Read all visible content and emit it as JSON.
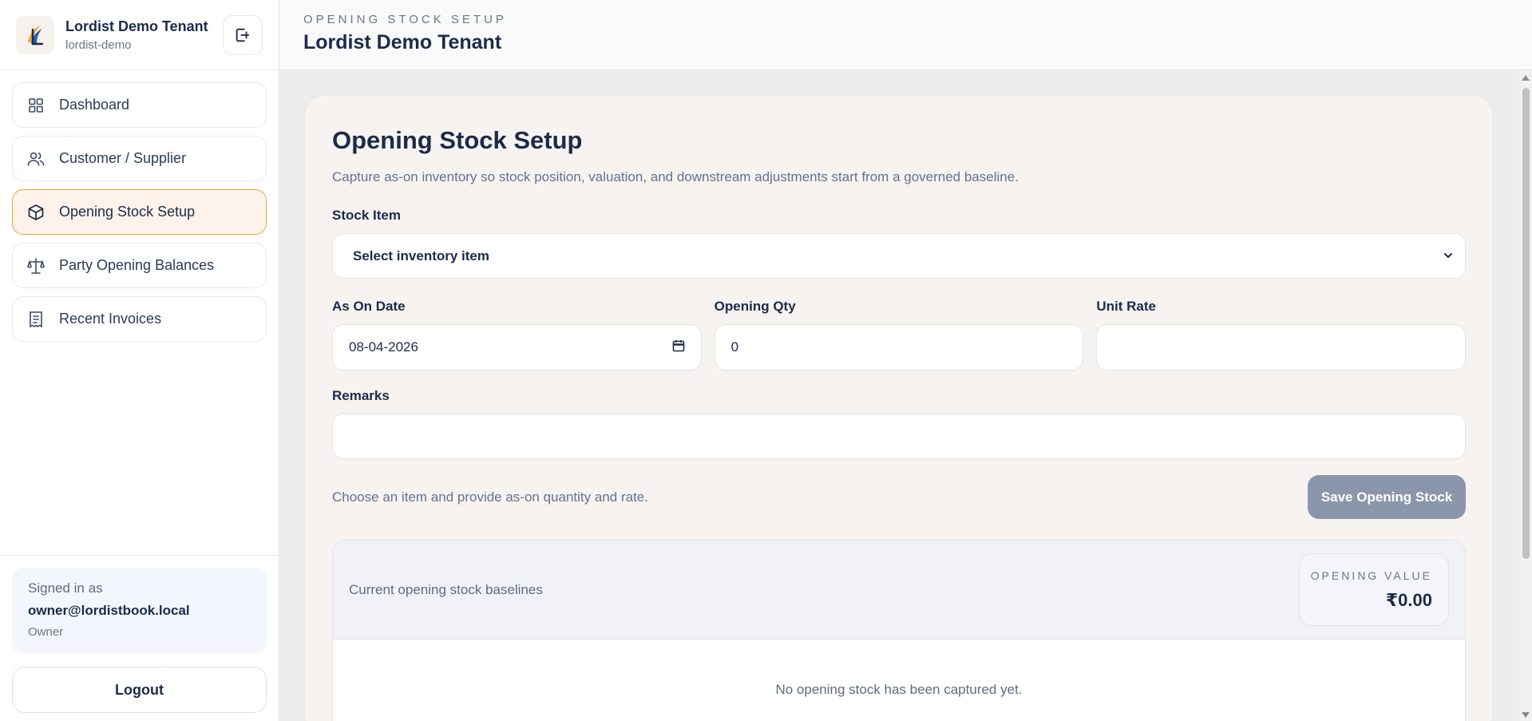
{
  "brand": {
    "title": "Lordist Demo Tenant",
    "subtitle": "lordist-demo",
    "logo_icon": "lordist-logo-icon",
    "collapse_icon": "sign-out-square-icon"
  },
  "sidebar": {
    "items": [
      {
        "label": "Dashboard",
        "icon": "grid-icon",
        "active": false
      },
      {
        "label": "Customer / Supplier",
        "icon": "users-icon",
        "active": false
      },
      {
        "label": "Opening Stock Setup",
        "icon": "box-icon",
        "active": true
      },
      {
        "label": "Party Opening Balances",
        "icon": "scale-icon",
        "active": false
      },
      {
        "label": "Recent Invoices",
        "icon": "receipt-icon",
        "active": false
      }
    ]
  },
  "user": {
    "signed_in_label": "Signed in as",
    "email": "owner@lordistbook.local",
    "role": "Owner",
    "logout_label": "Logout"
  },
  "header": {
    "eyebrow": "OPENING STOCK SETUP",
    "tenant": "Lordist Demo Tenant"
  },
  "form": {
    "title": "Opening Stock Setup",
    "description": "Capture as-on inventory so stock position, valuation, and downstream adjustments start from a governed baseline.",
    "stock_item_label": "Stock Item",
    "stock_item_value": "Select inventory item",
    "as_on_date_label": "As On Date",
    "as_on_date_value": "08-04-2026",
    "opening_qty_label": "Opening Qty",
    "opening_qty_value": "0",
    "unit_rate_label": "Unit Rate",
    "unit_rate_value": "",
    "remarks_label": "Remarks",
    "remarks_value": "",
    "hint": "Choose an item and provide as-on quantity and rate.",
    "save_label": "Save Opening Stock"
  },
  "baseline": {
    "caption": "Current opening stock baselines",
    "value_label": "OPENING VALUE",
    "value": "₹0.00",
    "empty_message": "No opening stock has been captured yet."
  },
  "colors": {
    "accent": "#e2a33a",
    "active_bg": "#fdf3ea",
    "primary_text": "#1c2b4a",
    "disabled_button": "#8b96ab"
  }
}
